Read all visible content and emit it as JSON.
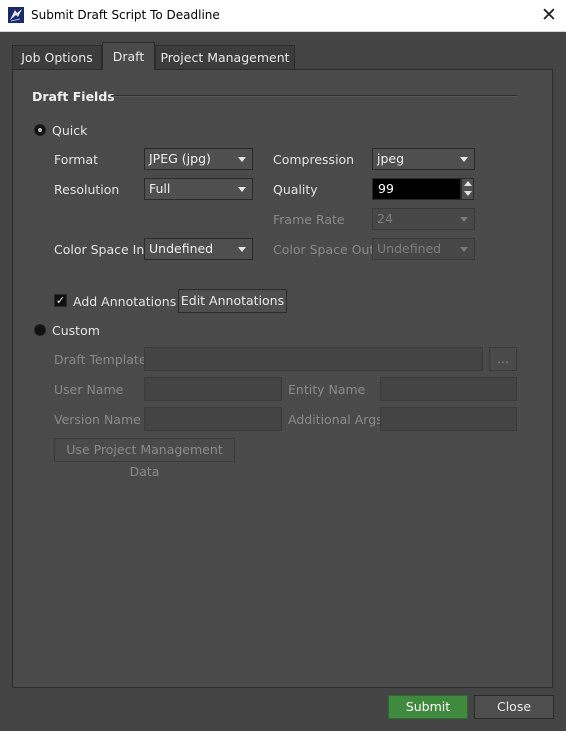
{
  "window": {
    "title": "Submit Draft Script To Deadline",
    "close_glyph": "✕",
    "app_icon": "deadline-app-icon"
  },
  "tabs": [
    {
      "label": "Job Options",
      "active": false
    },
    {
      "label": "Draft",
      "active": true
    },
    {
      "label": "Project Management",
      "active": false
    }
  ],
  "draft_fields": {
    "section_title": "Draft Fields",
    "quick": {
      "label": "Quick",
      "selected": true,
      "format": {
        "label": "Format",
        "value": "JPEG (jpg)"
      },
      "compression": {
        "label": "Compression",
        "value": "jpeg"
      },
      "resolution": {
        "label": "Resolution",
        "value": "Full"
      },
      "quality": {
        "label": "Quality",
        "value": "99"
      },
      "frame_rate": {
        "label": "Frame Rate",
        "value": "24",
        "enabled": false
      },
      "color_space_in": {
        "label": "Color Space In",
        "value": "Undefined"
      },
      "color_space_out": {
        "label": "Color Space Out",
        "value": "Undefined",
        "enabled": false
      },
      "add_annotations": {
        "label": "Add Annotations",
        "checked": true,
        "check_glyph": "✓"
      },
      "edit_annotations_label": "Edit Annotations"
    },
    "custom": {
      "label": "Custom",
      "selected": false,
      "draft_template_label": "Draft Template",
      "browse_label": "...",
      "user_name_label": "User Name",
      "entity_name_label": "Entity Name",
      "version_name_label": "Version Name",
      "additional_args_label": "Additional Args",
      "use_pm_data_label": "Use Project Management Data"
    }
  },
  "footer": {
    "submit_label": "Submit",
    "close_label": "Close"
  },
  "colors": {
    "background": "#444444",
    "panel": "#4a4a4a",
    "submit_accent": "#3f8a3f",
    "quality_field": "#000000"
  }
}
